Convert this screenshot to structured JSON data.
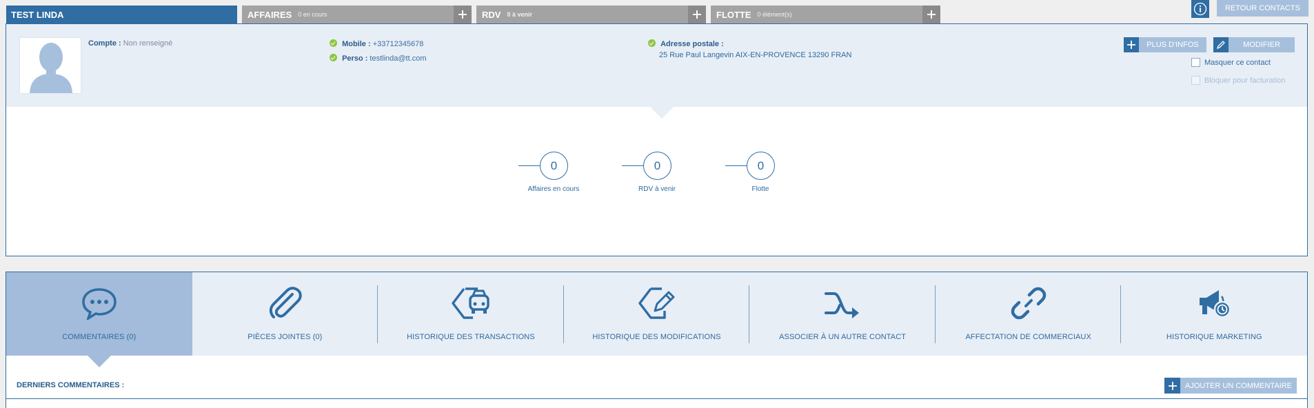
{
  "tabs": {
    "contact_name": "TEST LINDA",
    "affaires": {
      "title": "AFFAIRES",
      "sub": "0 en cours"
    },
    "rdv": {
      "title": "RDV",
      "sub": "0 à venir"
    },
    "flotte": {
      "title": "FLOTTE",
      "sub": "0 élément(s)"
    }
  },
  "header": {
    "retour_label": "RETOUR CONTACTS"
  },
  "contact": {
    "compte_label": "Compte :",
    "compte_value": "Non renseigné",
    "mobile_label": "Mobile :",
    "mobile_value": "+33712345678",
    "perso_label": "Perso :",
    "perso_value": "testlinda@tt.com",
    "adresse_label": "Adresse postale :",
    "adresse_value": "25 Rue Paul Langevin AIX-EN-PROVENCE 13290 FRAN"
  },
  "actions": {
    "plus_infos": "PLUS D'INFOS",
    "modifier": "MODIFIER",
    "masquer": "Masquer ce contact",
    "bloquer": "Bloquer pour facturation"
  },
  "stats": [
    {
      "value": "0",
      "label": "Affaires en cours"
    },
    {
      "value": "0",
      "label": "RDV à venir"
    },
    {
      "value": "0",
      "label": "Flotte"
    }
  ],
  "bottom_tabs": [
    {
      "label": "COMMENTAIRES (0)",
      "icon": "chat-bubble-icon"
    },
    {
      "label": "PIÈCES JOINTES (0)",
      "icon": "paperclip-icon"
    },
    {
      "label": "HISTORIQUE DES TRANSACTIONS",
      "icon": "car-tag-icon"
    },
    {
      "label": "HISTORIQUE DES MODIFICATIONS",
      "icon": "edit-tag-icon"
    },
    {
      "label": "ASSOCIER À UN AUTRE CONTACT",
      "icon": "merge-arrow-icon"
    },
    {
      "label": "AFFECTATION DE COMMERCIAUX",
      "icon": "link-icon"
    },
    {
      "label": "HISTORIQUE MARKETING",
      "icon": "megaphone-history-icon"
    }
  ],
  "comments": {
    "title": "DERNIERS COMMENTAIRES :",
    "add_label": "AJOUTER UN COMMENTAIRE"
  },
  "colors": {
    "primary": "#2f6da3",
    "light": "#a6bfdc",
    "panel_bg": "#e8eef6",
    "tab_gray": "#a3a3a3",
    "check_green": "#8dc63f"
  }
}
